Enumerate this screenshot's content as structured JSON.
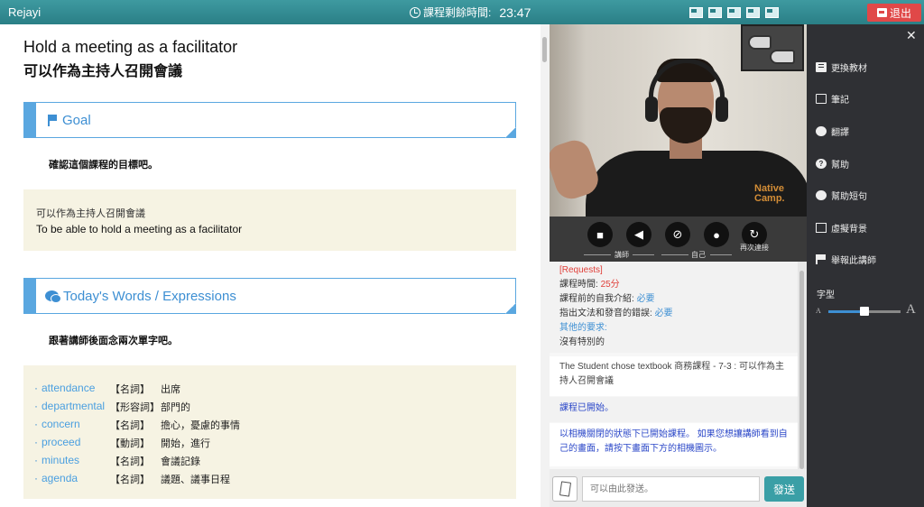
{
  "topbar": {
    "brand": "Rejayi",
    "timer_label": "課程剩餘時間:",
    "timer_value": "23:47",
    "exit_label": "退出"
  },
  "lesson": {
    "title_en": "Hold a meeting as a facilitator",
    "title_zh": "可以作為主持人召開會議",
    "goal": {
      "heading": "Goal",
      "instruction": "確認這個課程的目標吧。",
      "text_zh": "可以作為主持人召開會議",
      "text_en": "To be able to hold a meeting as a facilitator"
    },
    "words": {
      "heading": "Today's Words / Expressions",
      "instruction": "跟著講師後面念兩次單字吧。",
      "items": [
        {
          "word": "attendance",
          "pos": "【名詞】",
          "meaning": "出席"
        },
        {
          "word": "departmental",
          "pos": "【形容詞】",
          "meaning": "部門的"
        },
        {
          "word": "concern",
          "pos": "【名詞】",
          "meaning": "擔心，憂慮的事情"
        },
        {
          "word": "proceed",
          "pos": "【動詞】",
          "meaning": "開始，進行"
        },
        {
          "word": "minutes",
          "pos": "【名詞】",
          "meaning": "會議記錄"
        },
        {
          "word": "agenda",
          "pos": "【名詞】",
          "meaning": "議題、議事日程"
        }
      ]
    }
  },
  "video": {
    "watermark_line1": "Native",
    "watermark_line2": "Camp."
  },
  "controls": {
    "teacher_label": "講師",
    "self_label": "自己",
    "reconnect_label": "再次連接"
  },
  "chat": {
    "requests_title": "[Requests]",
    "duration_label": "課程時間:",
    "duration_value": "25分",
    "intro_label": "課程前的自我介紹:",
    "intro_value": "必要",
    "correct_label": "指出文法和發音的錯誤:",
    "correct_value": "必要",
    "other_label": "其他的要求:",
    "other_value": "沒有特別的",
    "textbook_msg": "The Student chose textbook 商務課程 - 7-3 : 可以作為主持人召開會議",
    "started_msg": "課程已開始。",
    "camera_msg": "以相機關閉的狀態下已開始課程。 如果您想讓講師看到自己的畫面，請按下畫面下方的相機圖示。",
    "input_placeholder": "可以由此發送。",
    "send_label": "發送"
  },
  "sidebar": {
    "items": [
      {
        "label": "更換教材",
        "icon": "book-icon"
      },
      {
        "label": "筆記",
        "icon": "edit-icon"
      },
      {
        "label": "翻譯",
        "icon": "globe-icon"
      },
      {
        "label": "幫助",
        "icon": "question-icon"
      },
      {
        "label": "幫助短句",
        "icon": "chat-icon"
      },
      {
        "label": "虛擬背景",
        "icon": "image-icon"
      },
      {
        "label": "舉報此講師",
        "icon": "flag-icon"
      }
    ],
    "font_label": "字型",
    "font_small": "A",
    "font_big": "A",
    "font_size_level": 0.5
  },
  "colors": {
    "topbar": "#3e9aa0",
    "accent_blue": "#3d8fd3",
    "exit_red": "#e04848",
    "send_teal": "#3a9fa6"
  }
}
